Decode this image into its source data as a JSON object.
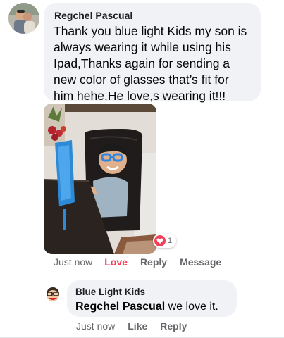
{
  "comment": {
    "author": "Regchel Pascual",
    "text": "Thank you blue light Kids my son is always wearing it while using his Ipad,Thanks again for sending a new color of glasses that’s fit for him hehe.He love,s wearing it!!!",
    "photo_icon": "child-wearing-blue-glasses-photo",
    "reaction": {
      "icon": "heart-icon",
      "count": "1"
    },
    "actions": {
      "time": "Just now",
      "love": "Love",
      "reply": "Reply",
      "message": "Message"
    }
  },
  "reply": {
    "author": "Blue Light Kids",
    "mention": "Regchel Pascual",
    "text": " we love it.",
    "actions": {
      "time": "Just now",
      "like": "Like",
      "reply": "Reply"
    }
  },
  "colors": {
    "bubble": "#f0f2f5",
    "love": "#f33e58",
    "meta": "#65676b",
    "text": "#050505"
  }
}
